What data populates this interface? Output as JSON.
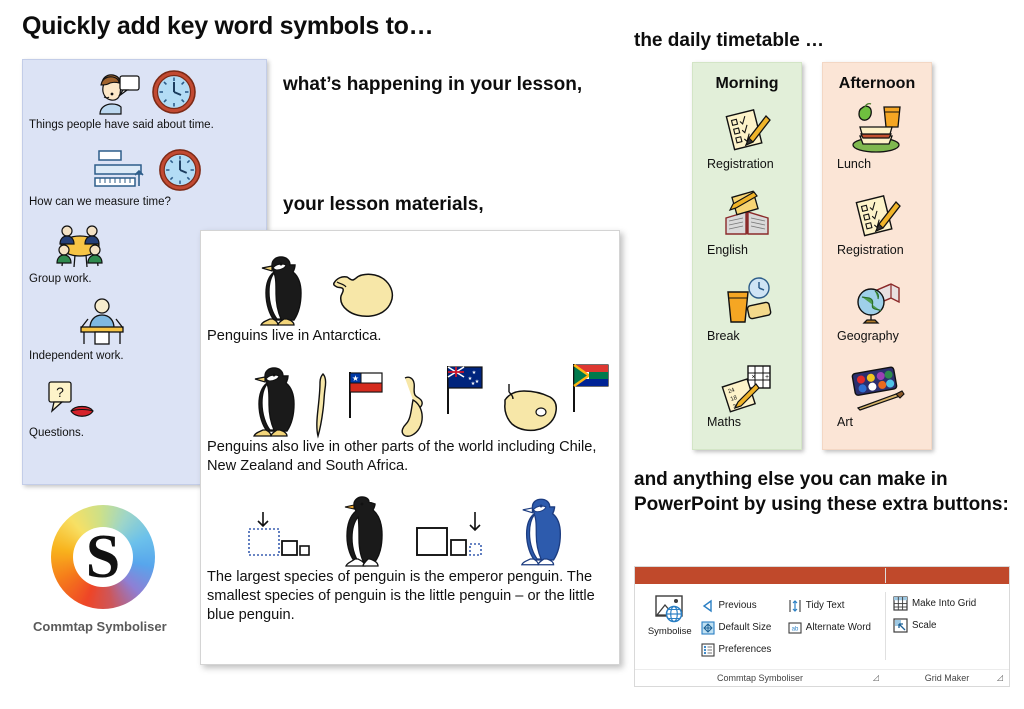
{
  "headings": {
    "main": "Quickly add key word symbols to…",
    "happening": "what’s happening in your lesson,",
    "materials": "your lesson materials,",
    "timetable": "the daily timetable …",
    "extra": "and anything else you can make in PowerPoint by using these extra buttons:"
  },
  "lesson_panel": {
    "background": "#dce3f5",
    "items": [
      {
        "label": "Things people have said about time.",
        "symbols": [
          "speaking-person-icon",
          "clock-icon"
        ]
      },
      {
        "label": "How can we measure time?",
        "symbols": [
          "ruler-measure-icon",
          "clock-icon"
        ]
      },
      {
        "label": "Group work.",
        "symbols": [
          "group-work-icon"
        ]
      },
      {
        "label": "Independent work.",
        "symbols": [
          "independent-work-icon"
        ]
      },
      {
        "label": "Questions.",
        "symbols": [
          "question-speech-icon",
          "mouth-icon"
        ]
      }
    ]
  },
  "penguin_card": {
    "background": "#ffffff",
    "blocks": [
      {
        "symbols": [
          "penguin-icon",
          "antarctica-map-icon"
        ],
        "text": "Penguins live in Antarctica."
      },
      {
        "symbols": [
          "penguin-icon",
          "chile-map-icon",
          "chile-flag-icon",
          "new-zealand-map-icon",
          "new-zealand-flag-icon",
          "south-africa-map-icon",
          "south-africa-flag-icon"
        ],
        "text": "Penguins also live in other parts of the world including Chile, New Zealand and South Africa."
      },
      {
        "symbols": [
          "largest-icon",
          "emperor-penguin-icon",
          "smallest-icon",
          "little-blue-penguin-icon"
        ],
        "text": "The largest species of penguin is the emperor penguin. The smallest species of penguin is the little penguin – or the little blue penguin."
      }
    ]
  },
  "timetable": {
    "morning": {
      "title": "Morning",
      "color": "#e2efd9",
      "items": [
        {
          "label": "Registration",
          "icon": "checklist-pencil-icon"
        },
        {
          "label": "English",
          "icon": "book-pencil-icon"
        },
        {
          "label": "Break",
          "icon": "drink-snack-clock-icon"
        },
        {
          "label": "Maths",
          "icon": "numbers-grid-icon"
        }
      ]
    },
    "afternoon": {
      "title": "Afternoon",
      "color": "#fbe5d6",
      "items": [
        {
          "label": "Lunch",
          "icon": "sandwich-apple-drink-icon"
        },
        {
          "label": "Registration",
          "icon": "checklist-pencil-icon"
        },
        {
          "label": "Geography",
          "icon": "globe-book-icon"
        },
        {
          "label": "Art",
          "icon": "paint-palette-icon"
        }
      ]
    }
  },
  "logo": {
    "letter": "S",
    "caption": "Commtap Symboliser"
  },
  "ribbon": {
    "accent_color": "#c0492b",
    "symboliser_group": {
      "name": "Commtap Symboliser",
      "big_button": {
        "label": "Symbolise",
        "icon": "picture-globe-icon"
      },
      "column_one": [
        {
          "label": "Previous",
          "icon": "previous-triangle-icon"
        },
        {
          "label": "Default Size",
          "icon": "default-size-icon"
        },
        {
          "label": "Preferences",
          "icon": "preferences-icon"
        }
      ],
      "column_two": [
        {
          "label": "Tidy Text",
          "icon": "tidy-text-icon"
        },
        {
          "label": "Alternate Word",
          "icon": "alternate-word-icon"
        }
      ],
      "dialog_launcher": "dialog-launcher-icon"
    },
    "grid_group": {
      "name": "Grid Maker",
      "buttons": [
        {
          "label": "Make Into Grid",
          "icon": "grid-table-icon"
        },
        {
          "label": "Scale",
          "icon": "scale-icon"
        }
      ],
      "dialog_launcher": "dialog-launcher-icon"
    }
  }
}
